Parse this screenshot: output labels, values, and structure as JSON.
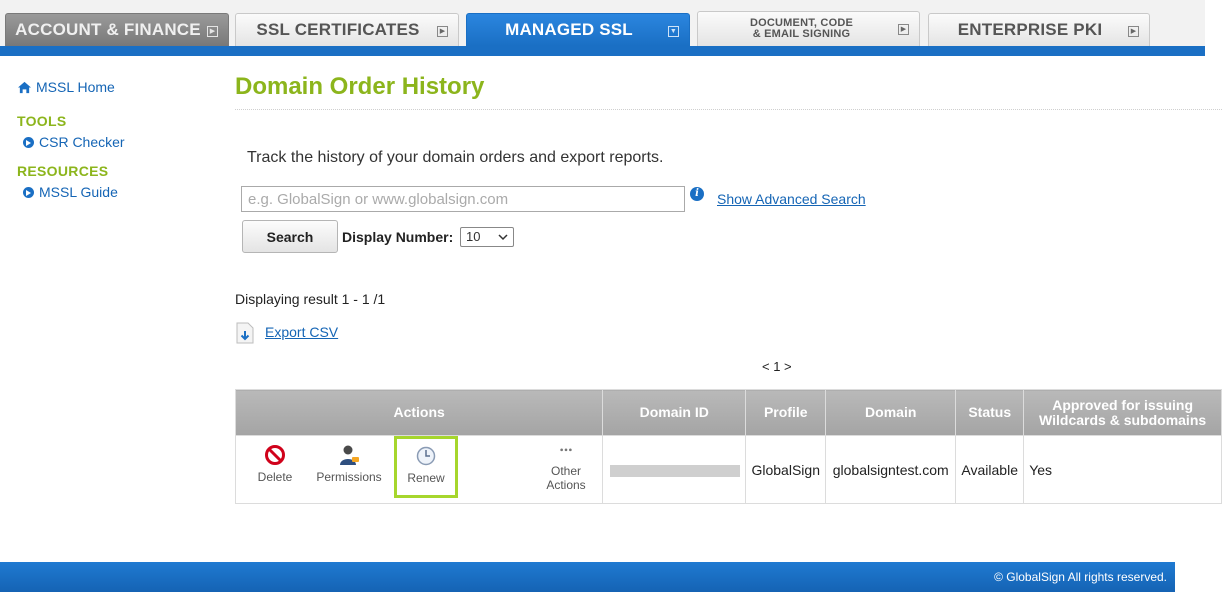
{
  "tabs": [
    {
      "label": "ACCOUNT & FINANCE"
    },
    {
      "label": "SSL CERTIFICATES"
    },
    {
      "label": "MANAGED SSL"
    },
    {
      "label": "DOCUMENT, CODE\n& EMAIL SIGNING"
    },
    {
      "label": "ENTERPRISE PKI"
    }
  ],
  "sidebar": {
    "home": "MSSL Home",
    "tools_heading": "TOOLS",
    "csr_checker": "CSR Checker",
    "resources_heading": "RESOURCES",
    "mssl_guide": "MSSL Guide"
  },
  "main": {
    "title": "Domain Order History",
    "intro": "Track the history of your domain orders and export reports.",
    "search_placeholder": "e.g. GlobalSign or www.globalsign.com",
    "search_value": "",
    "advanced_search": "Show Advanced Search",
    "search_button": "Search",
    "display_label": "Display Number:",
    "display_value": "10",
    "result_text": "Displaying result 1 - 1 /1",
    "export_csv": "Export CSV",
    "pager": "< 1 >"
  },
  "table": {
    "headers": {
      "actions": "Actions",
      "domain_id": "Domain ID",
      "profile": "Profile",
      "domain": "Domain",
      "status": "Status",
      "approved": "Approved for issuing Wildcards & subdomains"
    },
    "actions": {
      "delete": "Delete",
      "permissions": "Permissions",
      "renew": "Renew",
      "other": "Other Actions"
    },
    "rows": [
      {
        "profile": "GlobalSign",
        "domain": "globalsigntest.com",
        "status": "Available",
        "approved": "Yes"
      }
    ]
  },
  "footer": "© GlobalSign All rights reserved.",
  "colors": {
    "accent_green": "#8cb51c",
    "brand_blue": "#1a6fc4",
    "highlight": "#a6d62d"
  }
}
